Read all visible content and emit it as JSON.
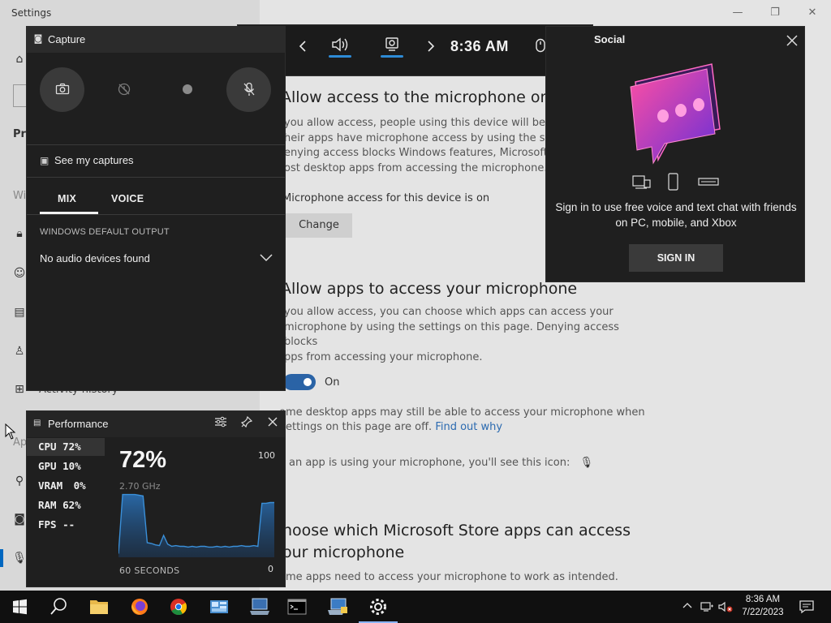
{
  "settings": {
    "title": "Settings",
    "sidebar_fragments": [
      "Pri",
      "Wi",
      "Ap"
    ],
    "activity_history": "Activity history",
    "sections": {
      "mic_access_title": "Allow access to the microphone on th",
      "mic_access_body": [
        "you allow access, people using this device will be ab",
        "heir apps have microphone access by using the setti",
        "enying access blocks Windows features, Microsoft S",
        "ost desktop apps from accessing the microphone."
      ],
      "mic_status": "Microphone access for this device is on",
      "change_label": "Change",
      "apps_title": "Allow apps to access your microphone",
      "apps_body": [
        "you allow access, you can choose which apps can access your",
        "microphone by using the settings on this page. Denying access blocks",
        "pps from accessing your microphone."
      ],
      "toggle_label": "On",
      "desktop_note_1": "ome desktop apps may still be able to access your microphone when",
      "desktop_note_2": "ettings on this page are off.",
      "find_out_why": "Find out why",
      "icon_note": "an app is using your microphone, you'll see this icon:",
      "store_title_1": "hoose which Microsoft Store apps can access",
      "store_title_2": "our microphone",
      "store_body": "ome apps need to access your microphone to work as intended."
    }
  },
  "gamebar": {
    "time": "8:36 AM"
  },
  "capture": {
    "title": "Capture",
    "see_captures": "See my captures",
    "tabs": [
      "MIX",
      "VOICE"
    ],
    "output_label": "WINDOWS DEFAULT OUTPUT",
    "output_value": "No audio devices found"
  },
  "social": {
    "title": "Social",
    "message": "Sign in to use free voice and text chat with friends on PC, mobile, and Xbox",
    "sign_in": "SIGN IN"
  },
  "performance": {
    "title": "Performance",
    "stats": [
      {
        "label": "CPU",
        "value": "72%"
      },
      {
        "label": "GPU",
        "value": "10%"
      },
      {
        "label": "VRAM",
        "value": "0%"
      },
      {
        "label": "RAM",
        "value": "62%"
      },
      {
        "label": "FPS",
        "value": "--"
      }
    ],
    "big_value": "72%",
    "frequency": "2.70 GHz",
    "max_label": "100",
    "min_label": "0",
    "window_label": "60 SECONDS",
    "cpu_history": [
      5,
      86,
      86,
      86,
      86,
      85,
      84,
      20,
      19,
      17,
      16,
      30,
      18,
      15,
      16,
      15,
      15,
      14,
      15,
      14,
      15,
      15,
      14,
      14,
      15,
      14,
      15,
      14,
      15,
      15,
      16,
      15,
      15,
      16,
      15,
      74,
      74,
      75,
      75
    ]
  },
  "taskbar": {
    "clock_time": "8:36 AM",
    "clock_date": "7/22/2023"
  },
  "colors": {
    "accent": "#2e8bd6",
    "widget_bg": "#1f1f1f",
    "graph_line": "#3a8fd8"
  }
}
